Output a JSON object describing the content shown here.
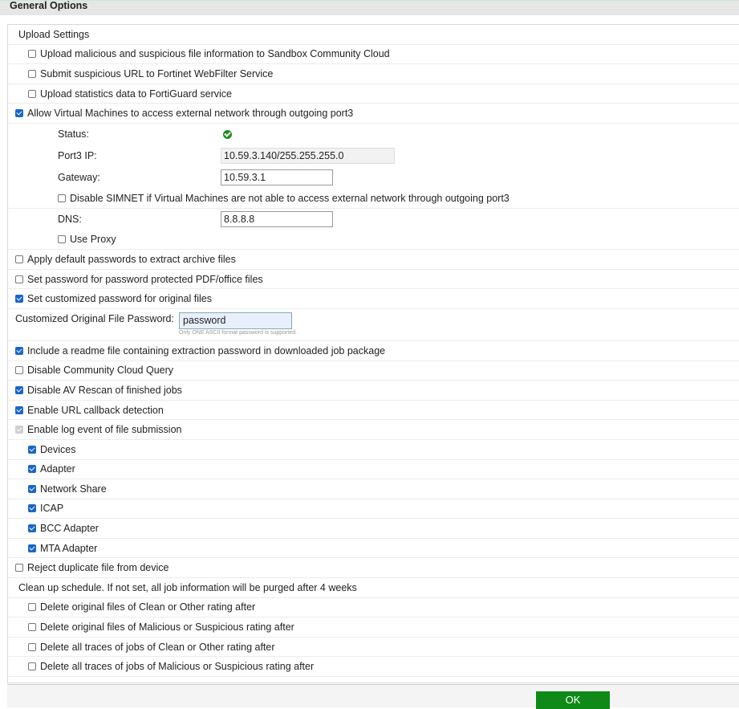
{
  "title": "General Options",
  "rows": [
    {
      "type": "header",
      "indent": 0,
      "label": "Upload Settings"
    },
    {
      "type": "check",
      "indent": 1,
      "state": "off",
      "label": "Upload malicious and suspicious file information to Sandbox Community Cloud"
    },
    {
      "type": "check",
      "indent": 1,
      "state": "off",
      "label": "Submit suspicious URL to Fortinet WebFilter Service"
    },
    {
      "type": "check",
      "indent": 1,
      "state": "off",
      "label": "Upload statistics data to FortiGuard service"
    },
    {
      "type": "check",
      "indent": 0,
      "state": "on",
      "label": "Allow Virtual Machines to access external network through outgoing port3"
    },
    {
      "type": "status",
      "label": "Status:",
      "value_icon": "check-circle-icon"
    },
    {
      "type": "field",
      "label": "Port3 IP:",
      "value": "10.59.3.140/255.255.255.0",
      "readonly": true
    },
    {
      "type": "field",
      "label": "Gateway:",
      "value": "10.59.3.1"
    },
    {
      "type": "check",
      "indent": 2,
      "state": "off",
      "label": "Disable SIMNET if Virtual Machines are not able to access external network through outgoing port3"
    },
    {
      "type": "field",
      "label": "DNS:",
      "value": "8.8.8.8"
    },
    {
      "type": "check",
      "indent": 2,
      "state": "off",
      "label": "Use Proxy"
    },
    {
      "type": "check",
      "indent": 0,
      "state": "off",
      "label": "Apply default passwords to extract archive files"
    },
    {
      "type": "check",
      "indent": 0,
      "state": "off",
      "label": "Set password for password protected PDF/office files"
    },
    {
      "type": "check",
      "indent": 0,
      "state": "on",
      "label": "Set customized password for original files"
    },
    {
      "type": "password",
      "label": "Customized Original File Password:",
      "value": "password",
      "hint": "Only ONE ASCII format password is supported."
    },
    {
      "type": "check",
      "indent": 0,
      "state": "on",
      "label": "Include a readme file containing extraction password in downloaded job package"
    },
    {
      "type": "check",
      "indent": 0,
      "state": "off",
      "label": "Disable Community Cloud Query"
    },
    {
      "type": "check",
      "indent": 0,
      "state": "on",
      "label": "Disable AV Rescan of finished jobs"
    },
    {
      "type": "check",
      "indent": 0,
      "state": "on",
      "label": "Enable URL callback detection"
    },
    {
      "type": "check",
      "indent": 0,
      "state": "dis",
      "label": "Enable log event of file submission"
    },
    {
      "type": "check",
      "indent": 1,
      "state": "on",
      "label": "Devices"
    },
    {
      "type": "check",
      "indent": 1,
      "state": "on",
      "label": "Adapter"
    },
    {
      "type": "check",
      "indent": 1,
      "state": "on",
      "label": "Network Share"
    },
    {
      "type": "check",
      "indent": 1,
      "state": "on",
      "label": "ICAP"
    },
    {
      "type": "check",
      "indent": 1,
      "state": "on",
      "label": "BCC Adapter"
    },
    {
      "type": "check",
      "indent": 1,
      "state": "on",
      "label": "MTA Adapter"
    },
    {
      "type": "check",
      "indent": 0,
      "state": "off",
      "label": "Reject duplicate file from device"
    },
    {
      "type": "header",
      "indent": 0,
      "label": "Clean up schedule. If not set, all job information will be purged after 4 weeks"
    },
    {
      "type": "check",
      "indent": 1,
      "state": "off",
      "label": "Delete original files of Clean or Other rating after"
    },
    {
      "type": "check",
      "indent": 1,
      "state": "off",
      "label": "Delete original files of Malicious or Suspicious rating after"
    },
    {
      "type": "check",
      "indent": 1,
      "state": "off",
      "label": "Delete all traces of jobs of Clean or Other rating after"
    },
    {
      "type": "check",
      "indent": 1,
      "state": "off",
      "label": "Delete all traces of jobs of Malicious or Suspicious rating after"
    }
  ],
  "ok_label": "OK"
}
